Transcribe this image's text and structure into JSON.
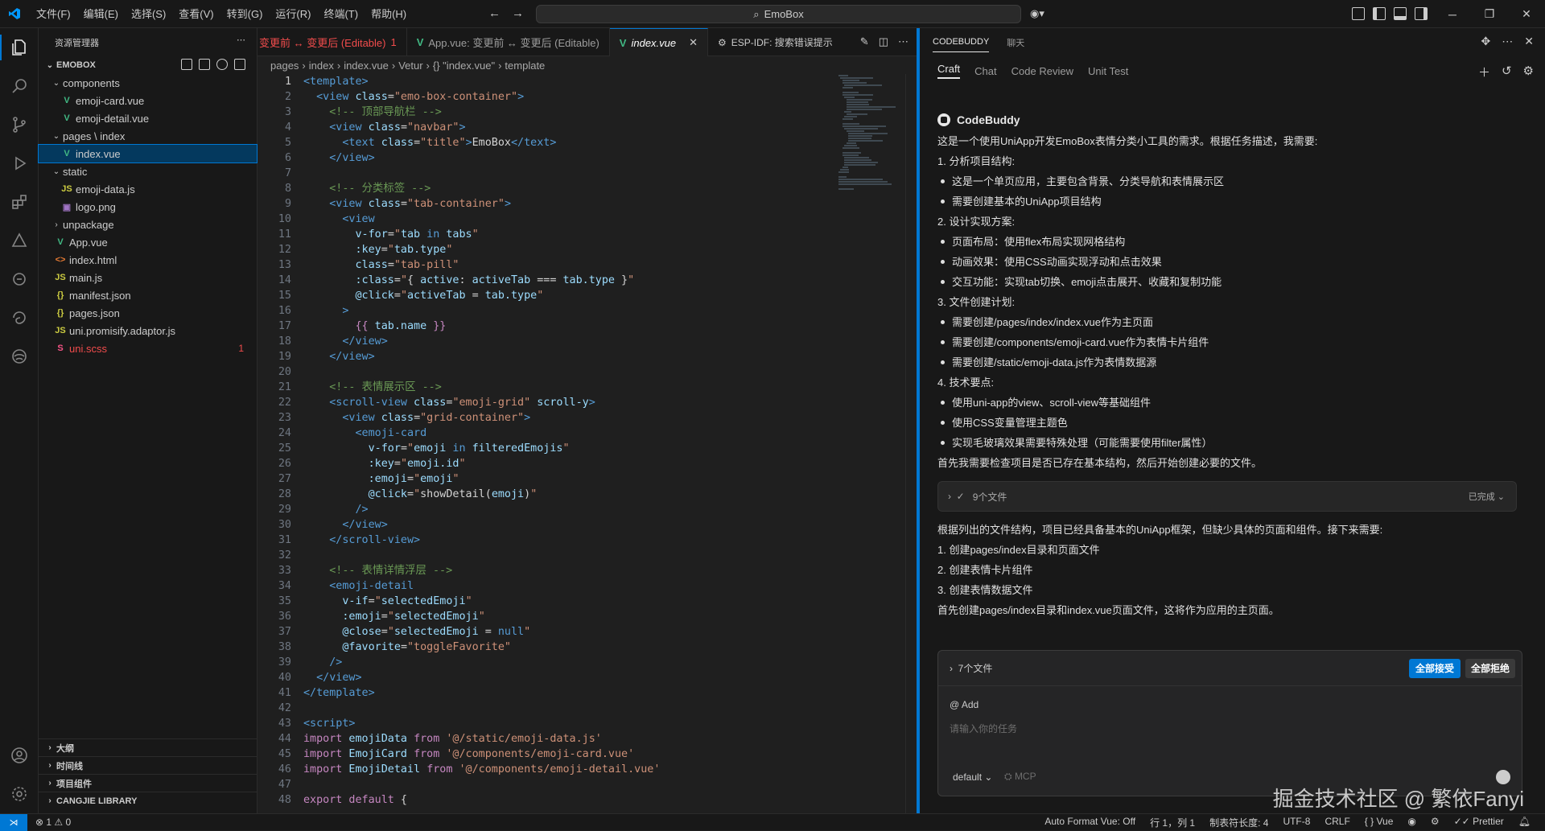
{
  "menu": [
    "文件(F)",
    "编辑(E)",
    "选择(S)",
    "查看(V)",
    "转到(G)",
    "运行(R)",
    "终端(T)",
    "帮助(H)"
  ],
  "command_center": "EmoBox",
  "sidebar": {
    "title": "资源管理器",
    "root": "EMOBOX",
    "tree": [
      {
        "label": "components",
        "type": "folder",
        "open": true,
        "depth": 1
      },
      {
        "label": "emoji-card.vue",
        "type": "vue",
        "depth": 2
      },
      {
        "label": "emoji-detail.vue",
        "type": "vue",
        "depth": 2
      },
      {
        "label": "pages \\ index",
        "type": "folder",
        "open": true,
        "depth": 1
      },
      {
        "label": "index.vue",
        "type": "vue",
        "depth": 2,
        "selected": true
      },
      {
        "label": "static",
        "type": "folder",
        "open": true,
        "depth": 1
      },
      {
        "label": "emoji-data.js",
        "type": "js",
        "depth": 2
      },
      {
        "label": "logo.png",
        "type": "img",
        "depth": 2
      },
      {
        "label": "unpackage",
        "type": "folder",
        "open": false,
        "depth": 1
      },
      {
        "label": "App.vue",
        "type": "vue",
        "depth": 1
      },
      {
        "label": "index.html",
        "type": "html",
        "depth": 1
      },
      {
        "label": "main.js",
        "type": "js",
        "depth": 1
      },
      {
        "label": "manifest.json",
        "type": "json",
        "depth": 1
      },
      {
        "label": "pages.json",
        "type": "json",
        "depth": 1
      },
      {
        "label": "uni.promisify.adaptor.js",
        "type": "js",
        "depth": 1
      },
      {
        "label": "uni.scss",
        "type": "scss",
        "depth": 1,
        "error": true,
        "badge": "1"
      }
    ],
    "bottom_sections": [
      "大纲",
      "时间线",
      "项目组件",
      "CANGJIE LIBRARY"
    ]
  },
  "tabs": [
    {
      "label": "变更前 ↔ 变更后 (Editable)",
      "badge": "1",
      "error": true
    },
    {
      "label": "App.vue: 变更前 ↔ 变更后 (Editable)"
    },
    {
      "label": "index.vue",
      "active": true
    }
  ],
  "tab_extra": "ESP-IDF: 搜索错误提示",
  "breadcrumb": [
    "pages",
    "index",
    "index.vue",
    "Vetur",
    "{} \"index.vue\"",
    "template"
  ],
  "code": [
    [
      [
        "t-tag",
        "<template>"
      ]
    ],
    [
      [
        "t-txt",
        "  "
      ],
      [
        "t-tag",
        "<view"
      ],
      [
        "t-attr",
        " class"
      ],
      [
        "t-txt",
        "="
      ],
      [
        "t-str",
        "\"emo-box-container\""
      ],
      [
        "t-tag",
        ">"
      ]
    ],
    [
      [
        "t-txt",
        "    "
      ],
      [
        "t-cmt",
        "<!-- 顶部导航栏 -->"
      ]
    ],
    [
      [
        "t-txt",
        "    "
      ],
      [
        "t-tag",
        "<view"
      ],
      [
        "t-attr",
        " class"
      ],
      [
        "t-txt",
        "="
      ],
      [
        "t-str",
        "\"navbar\""
      ],
      [
        "t-tag",
        ">"
      ]
    ],
    [
      [
        "t-txt",
        "      "
      ],
      [
        "t-tag",
        "<text"
      ],
      [
        "t-attr",
        " class"
      ],
      [
        "t-txt",
        "="
      ],
      [
        "t-str",
        "\"title\""
      ],
      [
        "t-tag",
        ">"
      ],
      [
        "t-txt",
        "EmoBox"
      ],
      [
        "t-tag",
        "</text>"
      ]
    ],
    [
      [
        "t-txt",
        "    "
      ],
      [
        "t-tag",
        "</view>"
      ]
    ],
    [],
    [
      [
        "t-txt",
        "    "
      ],
      [
        "t-cmt",
        "<!-- 分类标签 -->"
      ]
    ],
    [
      [
        "t-txt",
        "    "
      ],
      [
        "t-tag",
        "<view"
      ],
      [
        "t-attr",
        " class"
      ],
      [
        "t-txt",
        "="
      ],
      [
        "t-str",
        "\"tab-container\""
      ],
      [
        "t-tag",
        ">"
      ]
    ],
    [
      [
        "t-txt",
        "      "
      ],
      [
        "t-tag",
        "<view"
      ]
    ],
    [
      [
        "t-txt",
        "        "
      ],
      [
        "t-attr",
        "v-for"
      ],
      [
        "t-txt",
        "="
      ],
      [
        "t-str",
        "\""
      ],
      [
        "t-attr",
        "tab"
      ],
      [
        "t-ctl",
        " in "
      ],
      [
        "t-attr",
        "tabs"
      ],
      [
        "t-str",
        "\""
      ]
    ],
    [
      [
        "t-txt",
        "        "
      ],
      [
        "t-attr",
        ":key"
      ],
      [
        "t-txt",
        "="
      ],
      [
        "t-str",
        "\""
      ],
      [
        "t-attr",
        "tab.type"
      ],
      [
        "t-str",
        "\""
      ]
    ],
    [
      [
        "t-txt",
        "        "
      ],
      [
        "t-attr",
        "class"
      ],
      [
        "t-txt",
        "="
      ],
      [
        "t-str",
        "\"tab-pill\""
      ]
    ],
    [
      [
        "t-txt",
        "        "
      ],
      [
        "t-attr",
        ":class"
      ],
      [
        "t-txt",
        "="
      ],
      [
        "t-str",
        "\""
      ],
      [
        "t-txt",
        "{ "
      ],
      [
        "t-attr",
        "active"
      ],
      [
        "t-txt",
        ": "
      ],
      [
        "t-attr",
        "activeTab"
      ],
      [
        "t-txt",
        " === "
      ],
      [
        "t-attr",
        "tab.type"
      ],
      [
        "t-txt",
        " }"
      ],
      [
        "t-str",
        "\""
      ]
    ],
    [
      [
        "t-txt",
        "        "
      ],
      [
        "t-attr",
        "@click"
      ],
      [
        "t-txt",
        "="
      ],
      [
        "t-str",
        "\""
      ],
      [
        "t-attr",
        "activeTab"
      ],
      [
        "t-txt",
        " = "
      ],
      [
        "t-attr",
        "tab.type"
      ],
      [
        "t-str",
        "\""
      ]
    ],
    [
      [
        "t-txt",
        "      "
      ],
      [
        "t-tag",
        ">"
      ]
    ],
    [
      [
        "t-txt",
        "        "
      ],
      [
        "t-kw",
        "{{"
      ],
      [
        "t-attr",
        " tab.name "
      ],
      [
        "t-kw",
        "}}"
      ]
    ],
    [
      [
        "t-txt",
        "      "
      ],
      [
        "t-tag",
        "</view>"
      ]
    ],
    [
      [
        "t-txt",
        "    "
      ],
      [
        "t-tag",
        "</view>"
      ]
    ],
    [],
    [
      [
        "t-txt",
        "    "
      ],
      [
        "t-cmt",
        "<!-- 表情展示区 -->"
      ]
    ],
    [
      [
        "t-txt",
        "    "
      ],
      [
        "t-tag",
        "<scroll-view"
      ],
      [
        "t-attr",
        " class"
      ],
      [
        "t-txt",
        "="
      ],
      [
        "t-str",
        "\"emoji-grid\""
      ],
      [
        "t-attr",
        " scroll-y"
      ],
      [
        "t-tag",
        ">"
      ]
    ],
    [
      [
        "t-txt",
        "      "
      ],
      [
        "t-tag",
        "<view"
      ],
      [
        "t-attr",
        " class"
      ],
      [
        "t-txt",
        "="
      ],
      [
        "t-str",
        "\"grid-container\""
      ],
      [
        "t-tag",
        ">"
      ]
    ],
    [
      [
        "t-txt",
        "        "
      ],
      [
        "t-tag",
        "<emoji-card"
      ]
    ],
    [
      [
        "t-txt",
        "          "
      ],
      [
        "t-attr",
        "v-for"
      ],
      [
        "t-txt",
        "="
      ],
      [
        "t-str",
        "\""
      ],
      [
        "t-attr",
        "emoji"
      ],
      [
        "t-ctl",
        " in "
      ],
      [
        "t-attr",
        "filteredEmojis"
      ],
      [
        "t-str",
        "\""
      ]
    ],
    [
      [
        "t-txt",
        "          "
      ],
      [
        "t-attr",
        ":key"
      ],
      [
        "t-txt",
        "="
      ],
      [
        "t-str",
        "\""
      ],
      [
        "t-attr",
        "emoji.id"
      ],
      [
        "t-str",
        "\""
      ]
    ],
    [
      [
        "t-txt",
        "          "
      ],
      [
        "t-attr",
        ":emoji"
      ],
      [
        "t-txt",
        "="
      ],
      [
        "t-str",
        "\""
      ],
      [
        "t-attr",
        "emoji"
      ],
      [
        "t-str",
        "\""
      ]
    ],
    [
      [
        "t-txt",
        "          "
      ],
      [
        "t-attr",
        "@click"
      ],
      [
        "t-txt",
        "="
      ],
      [
        "t-str",
        "\""
      ],
      [
        "t-txt",
        "showDetail("
      ],
      [
        "t-attr",
        "emoji"
      ],
      [
        "t-txt",
        ")"
      ],
      [
        "t-str",
        "\""
      ]
    ],
    [
      [
        "t-txt",
        "        "
      ],
      [
        "t-tag",
        "/>"
      ]
    ],
    [
      [
        "t-txt",
        "      "
      ],
      [
        "t-tag",
        "</view>"
      ]
    ],
    [
      [
        "t-txt",
        "    "
      ],
      [
        "t-tag",
        "</scroll-view>"
      ]
    ],
    [],
    [
      [
        "t-txt",
        "    "
      ],
      [
        "t-cmt",
        "<!-- 表情详情浮层 -->"
      ]
    ],
    [
      [
        "t-txt",
        "    "
      ],
      [
        "t-tag",
        "<emoji-detail"
      ]
    ],
    [
      [
        "t-txt",
        "      "
      ],
      [
        "t-attr",
        "v-if"
      ],
      [
        "t-txt",
        "="
      ],
      [
        "t-str",
        "\""
      ],
      [
        "t-attr",
        "selectedEmoji"
      ],
      [
        "t-str",
        "\""
      ]
    ],
    [
      [
        "t-txt",
        "      "
      ],
      [
        "t-attr",
        ":emoji"
      ],
      [
        "t-txt",
        "="
      ],
      [
        "t-str",
        "\""
      ],
      [
        "t-attr",
        "selectedEmoji"
      ],
      [
        "t-str",
        "\""
      ]
    ],
    [
      [
        "t-txt",
        "      "
      ],
      [
        "t-attr",
        "@close"
      ],
      [
        "t-txt",
        "="
      ],
      [
        "t-str",
        "\""
      ],
      [
        "t-attr",
        "selectedEmoji"
      ],
      [
        "t-txt",
        " = "
      ],
      [
        "t-ctl",
        "null"
      ],
      [
        "t-str",
        "\""
      ]
    ],
    [
      [
        "t-txt",
        "      "
      ],
      [
        "t-attr",
        "@favorite"
      ],
      [
        "t-txt",
        "="
      ],
      [
        "t-str",
        "\"toggleFavorite\""
      ]
    ],
    [
      [
        "t-txt",
        "    "
      ],
      [
        "t-tag",
        "/>"
      ]
    ],
    [
      [
        "t-txt",
        "  "
      ],
      [
        "t-tag",
        "</view>"
      ]
    ],
    [
      [
        "t-tag",
        "</template>"
      ]
    ],
    [],
    [
      [
        "t-tag",
        "<script>"
      ]
    ],
    [
      [
        "t-kw",
        "import"
      ],
      [
        "t-attr",
        " emojiData "
      ],
      [
        "t-kw",
        "from"
      ],
      [
        "t-str",
        " '@/static/emoji-data.js'"
      ]
    ],
    [
      [
        "t-kw",
        "import"
      ],
      [
        "t-attr",
        " EmojiCard "
      ],
      [
        "t-kw",
        "from"
      ],
      [
        "t-str",
        " '@/components/emoji-card.vue'"
      ]
    ],
    [
      [
        "t-kw",
        "import"
      ],
      [
        "t-attr",
        " EmojiDetail "
      ],
      [
        "t-kw",
        "from"
      ],
      [
        "t-str",
        " '@/components/emoji-detail.vue'"
      ]
    ],
    [],
    [
      [
        "t-kw",
        "export"
      ],
      [
        "t-kw",
        " default"
      ],
      [
        "t-txt",
        " {"
      ]
    ]
  ],
  "right_panel": {
    "tabs": [
      "CODEBUDDY",
      "聊天"
    ],
    "subtabs": [
      "Craft",
      "Chat",
      "Code Review",
      "Unit Test"
    ],
    "bot_name": "CodeBuddy",
    "messages": [
      {
        "text": "这是一个使用UniApp开发EmoBox表情分类小工具的需求。根据任务描述，我需要:"
      },
      {
        "text": "1. 分析项目结构:"
      },
      {
        "text": "这是一个单页应用，主要包含背景、分类导航和表情展示区",
        "bullet": true
      },
      {
        "text": "需要创建基本的UniApp项目结构",
        "bullet": true
      },
      {
        "text": "2. 设计实现方案:"
      },
      {
        "text": "页面布局：使用flex布局实现网格结构",
        "bullet": true
      },
      {
        "text": "动画效果：使用CSS动画实现浮动和点击效果",
        "bullet": true
      },
      {
        "text": "交互功能：实现tab切换、emoji点击展开、收藏和复制功能",
        "bullet": true
      },
      {
        "text": "3. 文件创建计划:"
      },
      {
        "text": "需要创建/pages/index/index.vue作为主页面",
        "bullet": true
      },
      {
        "text": "需要创建/components/emoji-card.vue作为表情卡片组件",
        "bullet": true
      },
      {
        "text": "需要创建/static/emoji-data.js作为表情数据源",
        "bullet": true
      },
      {
        "text": "4. 技术要点:"
      },
      {
        "text": "使用uni-app的view、scroll-view等基础组件",
        "bullet": true
      },
      {
        "text": "使用CSS变量管理主题色",
        "bullet": true
      },
      {
        "text": "实现毛玻璃效果需要特殊处理（可能需要使用filter属性）",
        "bullet": true
      },
      {
        "text": "首先我需要检查项目是否已存在基本结构，然后开始创建必要的文件。"
      }
    ],
    "files_box": {
      "label": "9个文件",
      "status": "已完成"
    },
    "messages2": [
      {
        "text": "根据列出的文件结构，项目已经具备基本的UniApp框架，但缺少具体的页面和组件。接下来需要:"
      },
      {
        "text": "1. 创建pages/index目录和页面文件"
      },
      {
        "text": "2. 创建表情卡片组件"
      },
      {
        "text": "3. 创建表情数据文件"
      },
      {
        "text": "首先创建pages/index目录和index.vue页面文件，这将作为应用的主页面。"
      }
    ],
    "input": {
      "files_label": "7个文件",
      "accept_all": "全部接受",
      "reject_all": "全部拒绝",
      "add": "@ Add",
      "placeholder": "请输入你的任务",
      "mode": "default",
      "mcp": "MCP"
    }
  },
  "watermark": "掘金技术社区 @ 繁依Fanyi",
  "status": {
    "errors": "1",
    "warnings": "0",
    "auto_format": "Auto Format Vue: Off",
    "position": "行 1，列 1",
    "tab_size": "制表符长度: 4",
    "encoding": "UTF-8",
    "eol": "CRLF",
    "language": "Vue",
    "prettier": "Prettier"
  },
  "colors": {
    "accent": "#0078d4",
    "vue_green": "#41b883",
    "js_yellow": "#cbcb41",
    "error": "#f14c4c"
  }
}
